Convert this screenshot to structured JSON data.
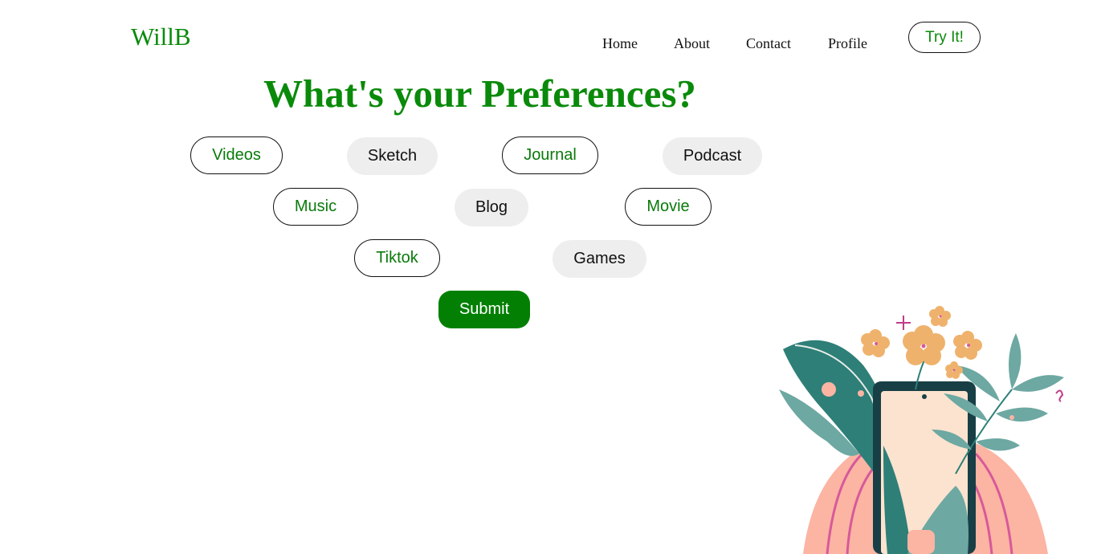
{
  "header": {
    "logo": "WillB",
    "nav": [
      "Home",
      "About",
      "Contact",
      "Profile"
    ],
    "cta": "Try It!"
  },
  "main": {
    "title": "What's your Preferences?",
    "options": [
      {
        "label": "Videos",
        "selected": false
      },
      {
        "label": "Sketch",
        "selected": true
      },
      {
        "label": "Journal",
        "selected": false
      },
      {
        "label": "Podcast",
        "selected": true
      },
      {
        "label": "Music",
        "selected": false
      },
      {
        "label": "Blog",
        "selected": true
      },
      {
        "label": "Movie",
        "selected": false
      },
      {
        "label": "Tiktok",
        "selected": false
      },
      {
        "label": "Games",
        "selected": true
      }
    ],
    "submit": "Submit"
  },
  "colors": {
    "brand_green": "#0a8a0a",
    "submit_green": "#038003",
    "selected_bg": "#eeeeee"
  }
}
